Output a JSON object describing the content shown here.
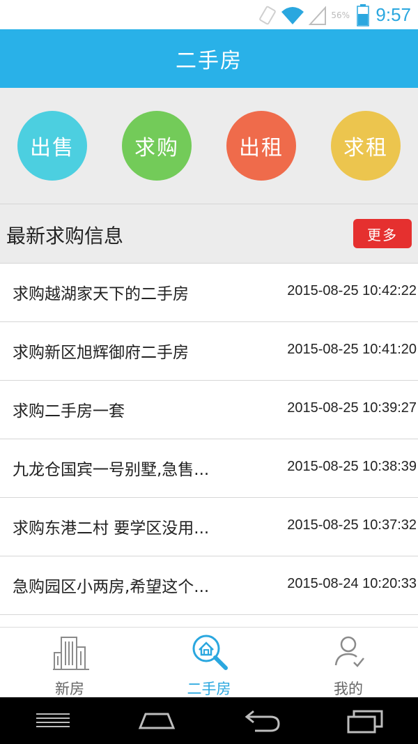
{
  "status_bar": {
    "battery_percent": "56%",
    "time": "9:57",
    "icons": [
      "rotate-icon",
      "wifi-icon",
      "signal-icon",
      "battery-icon"
    ]
  },
  "header": {
    "title": "二手房"
  },
  "categories": [
    {
      "label": "出售",
      "color": "#4ccfe0"
    },
    {
      "label": "求购",
      "color": "#73cb59"
    },
    {
      "label": "出租",
      "color": "#ef6b4b"
    },
    {
      "label": "求租",
      "color": "#ecc54e"
    }
  ],
  "section": {
    "title": "最新求购信息",
    "more_label": "更多"
  },
  "listings": [
    {
      "title": "求购越湖家天下的二手房",
      "date": "2015-08-25 10:42:22"
    },
    {
      "title": "求购新区旭辉御府二手房",
      "date": "2015-08-25 10:41:20"
    },
    {
      "title": "求购二手房一套",
      "date": "2015-08-25 10:39:27"
    },
    {
      "title": "九龙仓国宾一号别墅,急售...",
      "date": "2015-08-25 10:38:39"
    },
    {
      "title": "求购东港二村 要学区没用...",
      "date": "2015-08-25 10:37:32"
    },
    {
      "title": "急购园区小两房,希望这个...",
      "date": "2015-08-24 10:20:33"
    }
  ],
  "tabs": [
    {
      "label": "新房",
      "icon": "building-icon",
      "active": false
    },
    {
      "label": "二手房",
      "icon": "house-search-icon",
      "active": true
    },
    {
      "label": "我的",
      "icon": "user-icon",
      "active": false
    }
  ],
  "nav_bar": {
    "icons": [
      "menu-icon",
      "home-icon",
      "back-icon",
      "recents-icon"
    ]
  },
  "colors": {
    "accent": "#29b1e8",
    "more_button": "#e5302f"
  }
}
